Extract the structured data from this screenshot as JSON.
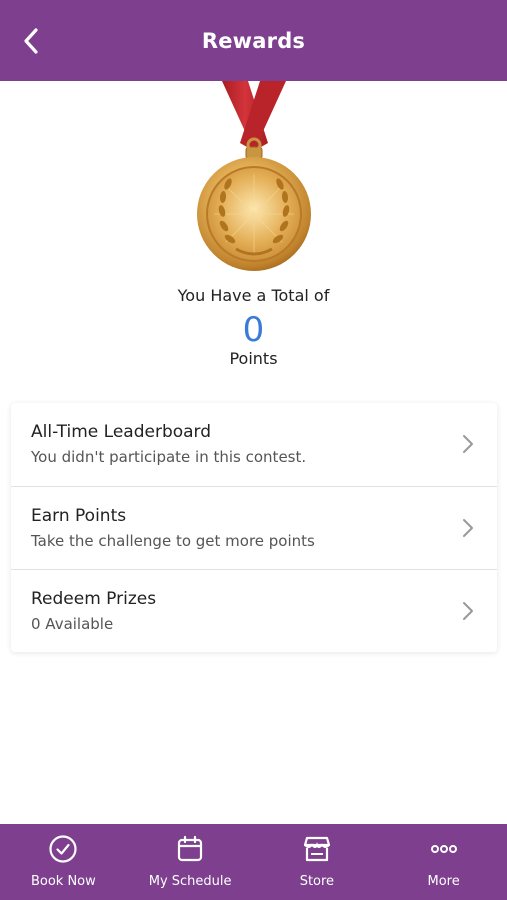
{
  "header": {
    "title": "Rewards",
    "back_icon": "chevron-left-icon"
  },
  "summary": {
    "total_label": "You Have a Total of",
    "points_value": "0",
    "points_label": "Points",
    "medal_icon": "gold-medal-icon"
  },
  "menu": {
    "items": [
      {
        "title": "All-Time Leaderboard",
        "subtitle": "You didn't participate in this contest.",
        "icon": "chevron-right-icon"
      },
      {
        "title": "Earn Points",
        "subtitle": "Take the challenge to get more points",
        "icon": "chevron-right-icon"
      },
      {
        "title": "Redeem Prizes",
        "subtitle": "0 Available",
        "icon": "chevron-right-icon"
      }
    ]
  },
  "tabbar": {
    "items": [
      {
        "label": "Book Now",
        "icon": "check-circle-icon"
      },
      {
        "label": "My Schedule",
        "icon": "calendar-icon"
      },
      {
        "label": "Store",
        "icon": "store-icon"
      },
      {
        "label": "More",
        "icon": "more-dots-icon"
      }
    ]
  },
  "colors": {
    "brand_purple": "#7e3f8f",
    "points_blue": "#3a7bd5",
    "ribbon_red": "#c0272d",
    "medal_gold": "#d9a441"
  }
}
